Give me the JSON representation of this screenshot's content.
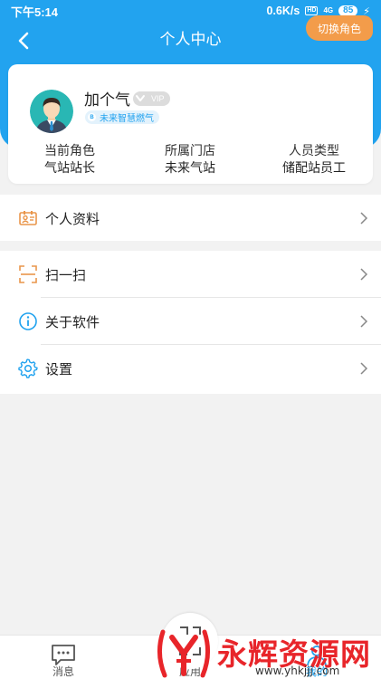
{
  "status_bar": {
    "time": "下午5:14",
    "network_speed": "0.6K/s",
    "hd": "HD",
    "signal": "4G",
    "battery": "85"
  },
  "header": {
    "title": "个人中心",
    "back_icon": "chevron-left-icon"
  },
  "profile": {
    "name": "加个气",
    "vip_label": "VIP",
    "company_tag": "未来智慧燃气",
    "company_tag_icon": "B",
    "switch_role_label": "切换角色",
    "info": [
      {
        "label": "当前角色",
        "value": "气站站长"
      },
      {
        "label": "所属门店",
        "value": "未来气站"
      },
      {
        "label": "人员类型",
        "value": "储配站员工"
      }
    ]
  },
  "menu": {
    "group1": [
      {
        "label": "个人资料",
        "icon": "id-card-icon"
      }
    ],
    "group2": [
      {
        "label": "扫一扫",
        "icon": "scan-icon"
      },
      {
        "label": "关于软件",
        "icon": "info-icon"
      },
      {
        "label": "设置",
        "icon": "gear-icon"
      }
    ]
  },
  "tab_bar": {
    "tabs": [
      {
        "label": "消息",
        "icon": "chat-icon"
      },
      {
        "label": "应用",
        "icon": "apps-icon"
      },
      {
        "label": "我的",
        "icon": "user-icon"
      }
    ]
  },
  "watermark": {
    "text": "永辉资源网",
    "url": "www.yhkjjj.com"
  },
  "colors": {
    "primary": "#22a3ef",
    "accent_orange": "#f39c4a",
    "icon_orange": "#e9964b",
    "background": "#f2f2f2",
    "watermark_red": "#e8252a"
  }
}
